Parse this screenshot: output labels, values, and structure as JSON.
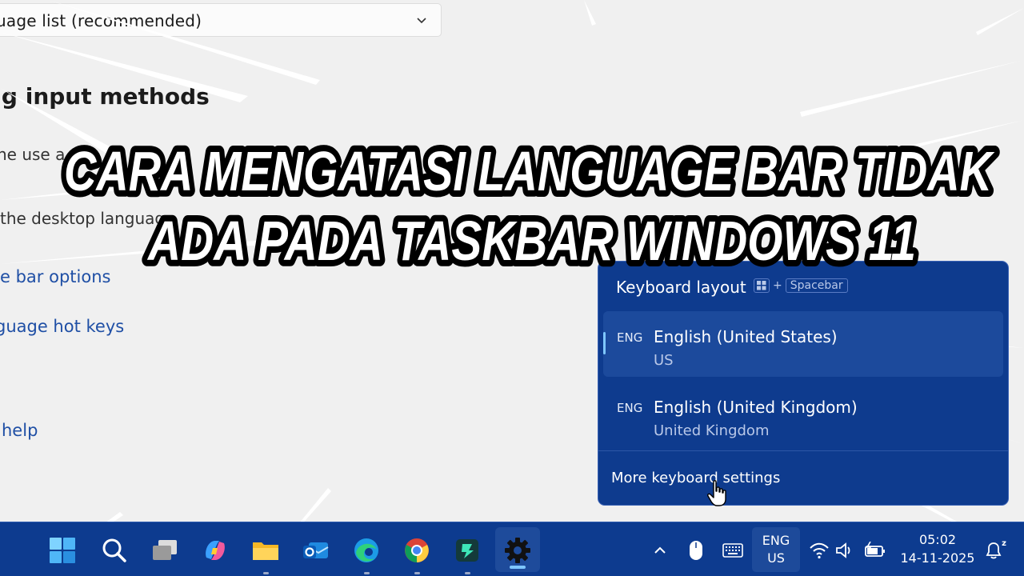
{
  "settings": {
    "dropdown_value": "uage list (recommended)",
    "section_heading": "ng input methods",
    "desc_1": "he use a",
    "desc_2": "the desktop languag",
    "links": [
      {
        "label": "e bar options"
      },
      {
        "label": "guage hot keys"
      },
      {
        "label": "help"
      }
    ]
  },
  "overlay_title": {
    "line1": "CARA MENGATASI LANGUAGE BAR TIDAK",
    "line2": "ADA PADA TASKBAR WINDOWS 11"
  },
  "flyout": {
    "title": "Keyboard layout",
    "shortcut_plus": "+",
    "shortcut_key": "Spacebar",
    "items": [
      {
        "tag": "ENG",
        "name": "English (United States)",
        "sub": "US",
        "selected": true
      },
      {
        "tag": "ENG",
        "name": "English (United Kingdom)",
        "sub": "United Kingdom",
        "selected": false
      }
    ],
    "more_link": "More keyboard settings"
  },
  "taskbar": {
    "apps": [
      {
        "name": "start-icon",
        "running": false
      },
      {
        "name": "search-icon",
        "running": false
      },
      {
        "name": "task-view-icon",
        "running": false
      },
      {
        "name": "copilot-icon",
        "running": false
      },
      {
        "name": "file-explorer-icon",
        "running": true
      },
      {
        "name": "outlook-icon",
        "running": false
      },
      {
        "name": "edge-icon",
        "running": true
      },
      {
        "name": "chrome-icon",
        "running": true
      },
      {
        "name": "filmora-icon",
        "running": true
      },
      {
        "name": "settings-icon",
        "running": true,
        "active": true
      }
    ],
    "tray": {
      "ime_line1": "ENG",
      "ime_line2": "US",
      "time": "05:02",
      "date": "14-11-2025",
      "notification_badge": "z"
    }
  },
  "colors": {
    "taskbar": "#0d3b8f",
    "flyout": "#0e3b8e",
    "link": "#1f4fa5",
    "accent": "#7fc7ff"
  }
}
